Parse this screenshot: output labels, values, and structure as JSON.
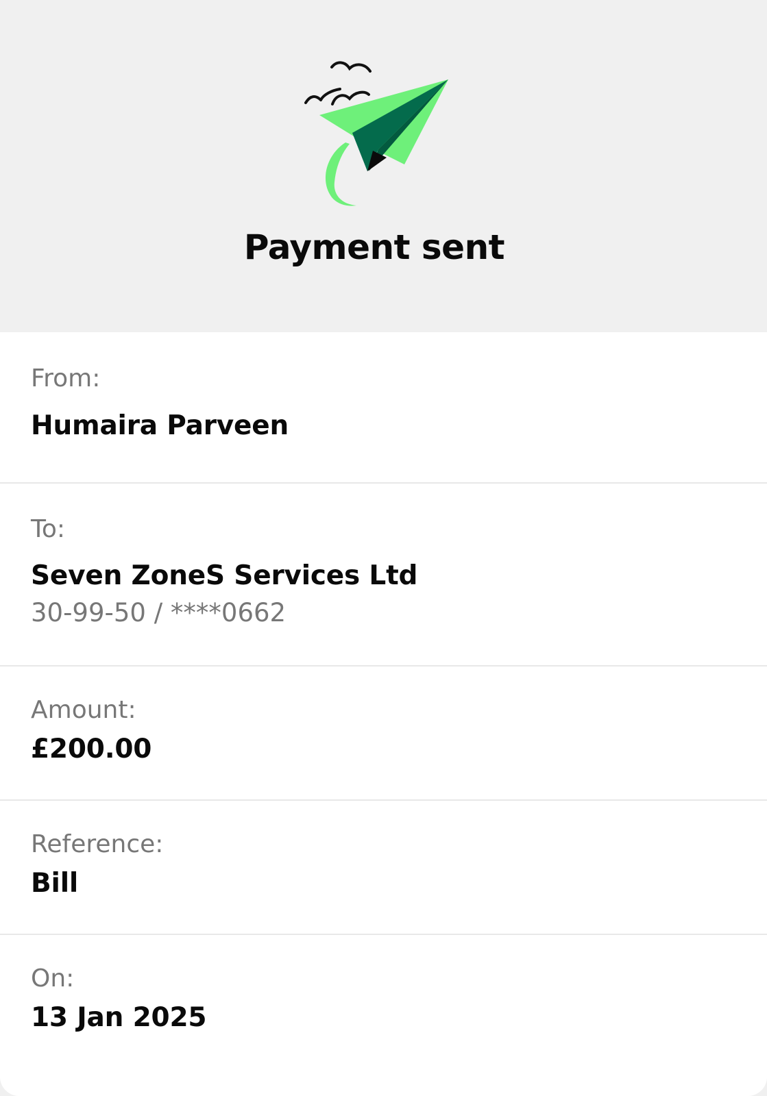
{
  "header": {
    "illustration_icon": "paper-plane-icon",
    "title": "Payment sent"
  },
  "details": {
    "from": {
      "label": "From:",
      "value": "Humaira Parveen"
    },
    "to": {
      "label": "To:",
      "value": "Seven ZoneS Services Ltd",
      "account": "30-99-50 / ****0662"
    },
    "amount": {
      "label": "Amount:",
      "value": "£200.00"
    },
    "reference": {
      "label": "Reference:",
      "value": "Bill"
    },
    "date": {
      "label": "On:",
      "value": "13 Jan 2025"
    }
  },
  "colors": {
    "background": "#f0f0f0",
    "card": "#ffffff",
    "plane_light": "#6ef07a",
    "plane_dark": "#046b4c",
    "label_text": "#777777",
    "value_text": "#0a0a0a"
  }
}
